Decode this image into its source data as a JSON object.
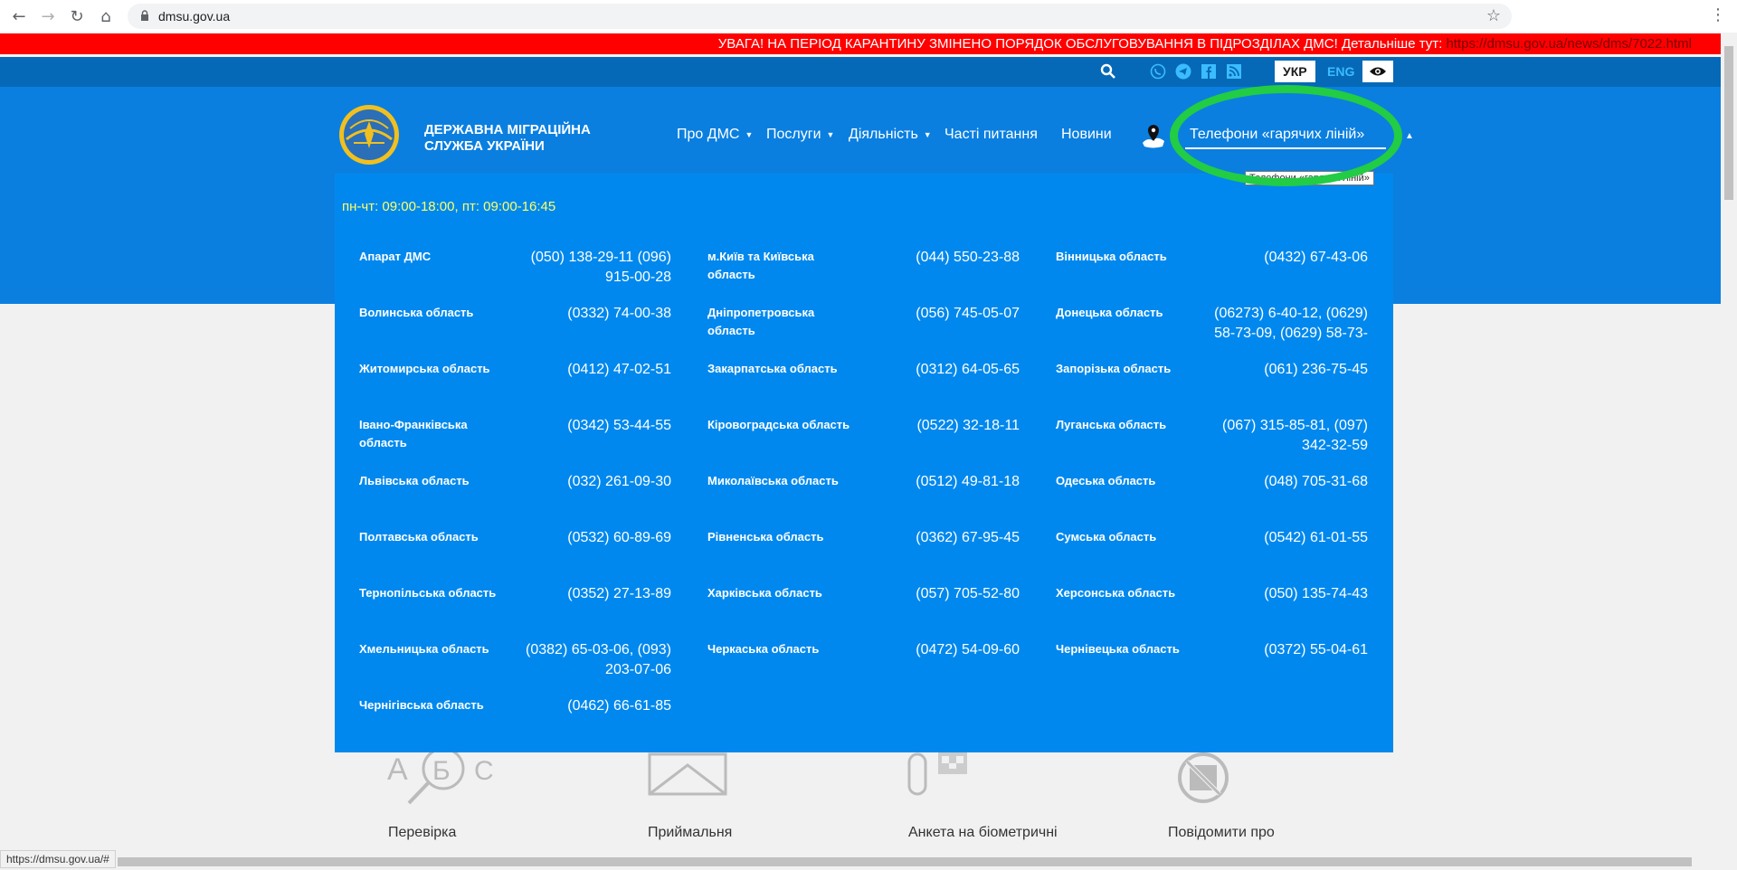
{
  "browser": {
    "url": "dmsu.gov.ua",
    "status_url": "https://dmsu.gov.ua/#"
  },
  "alert": {
    "text": "УВАГА! НА ПЕРІОД КАРАНТИНУ ЗМІНЕНО ПОРЯДОК ОБСЛУГОВУВАННЯ В ПІДРОЗДІЛАХ ДМС! Детальніше тут: ",
    "link": "https://dmsu.gov.ua/news/dms/7022.html"
  },
  "topbar": {
    "lang_active": "УКР",
    "lang_other": "ENG"
  },
  "header": {
    "site_title": "ДЕРЖАВНА МІГРАЦІЙНА СЛУЖБА УКРАЇНИ",
    "nav": {
      "about": "Про ДМС",
      "services": "Послуги",
      "activity": "Діяльність",
      "faq": "Часті питання",
      "news": "Новини"
    },
    "hotlines": "Телефони «гарячих ліній»",
    "tooltip": "Телефони «гарячих ліній»"
  },
  "dropdown": {
    "hours": "пн-чт: 09:00-18:00, пт: 09:00-16:45",
    "entries": [
      {
        "name": "Апарат ДМС",
        "phone": "(050) 138-29-11 (096) 915-00-28"
      },
      {
        "name": "м.Київ та Київська область",
        "phone": "(044) 550-23-88"
      },
      {
        "name": "Вінницька область",
        "phone": "(0432) 67-43-06"
      },
      {
        "name": "Волинська область",
        "phone": "(0332) 74-00-38"
      },
      {
        "name": "Дніпропетровська область",
        "phone": "(056) 745-05-07"
      },
      {
        "name": "Донецька область",
        "phone": "(06273) 6-40-12, (0629) 58-73-09, (0629) 58-73-"
      },
      {
        "name": "Житомирська область",
        "phone": "(0412) 47-02-51"
      },
      {
        "name": "Закарпатська область",
        "phone": "(0312) 64-05-65"
      },
      {
        "name": "Запорізька область",
        "phone": "(061) 236-75-45"
      },
      {
        "name": "Івано-Франківська область",
        "phone": "(0342) 53-44-55"
      },
      {
        "name": "Кіровоградська область",
        "phone": "(0522) 32-18-11"
      },
      {
        "name": "Луганська область",
        "phone": "(067) 315-85-81, (097) 342-32-59"
      },
      {
        "name": "Львівська область",
        "phone": "(032) 261-09-30"
      },
      {
        "name": "Миколаївська область",
        "phone": "(0512) 49-81-18"
      },
      {
        "name": "Одеська область",
        "phone": "(048) 705-31-68"
      },
      {
        "name": "Полтавська область",
        "phone": "(0532) 60-89-69"
      },
      {
        "name": "Рівненська область",
        "phone": "(0362) 67-95-45"
      },
      {
        "name": "Сумська область",
        "phone": "(0542) 61-01-55"
      },
      {
        "name": "Тернопільська область",
        "phone": "(0352) 27-13-89"
      },
      {
        "name": "Харківська область",
        "phone": "(057) 705-52-80"
      },
      {
        "name": "Херсонська область",
        "phone": "(050) 135-74-43"
      },
      {
        "name": "Хмельницька область",
        "phone": "(0382) 65-03-06, (093) 203-07-06"
      },
      {
        "name": "Черкаська область",
        "phone": "(0472) 54-09-60"
      },
      {
        "name": "Чернівецька область",
        "phone": "(0372) 55-04-61"
      },
      {
        "name": "Чернігівська область",
        "phone": "(0462) 66-61-85"
      }
    ]
  },
  "services": {
    "labels": [
      "Перевірка",
      "Приймальня",
      "Анкета на біометричні",
      "Повідомити про"
    ]
  },
  "colors": {
    "header_blue": "#0a7fe0",
    "dropdown_blue": "#0088ee",
    "topbar_blue": "#0569b8",
    "alert_red": "#ff0000",
    "hours_yellow": "#ffff66",
    "highlight_green": "#22cc44"
  }
}
